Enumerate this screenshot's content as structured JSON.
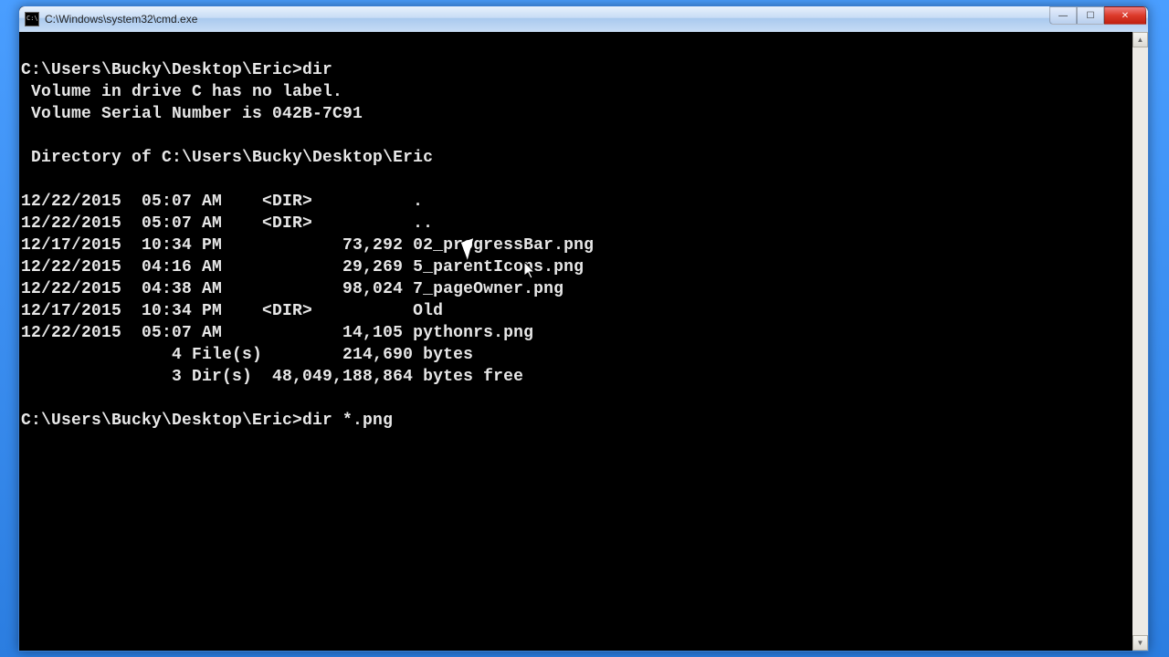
{
  "window": {
    "title": "C:\\Windows\\system32\\cmd.exe"
  },
  "term": {
    "l00": "",
    "l01": "C:\\Users\\Bucky\\Desktop\\Eric>dir",
    "l02": " Volume in drive C has no label.",
    "l03": " Volume Serial Number is 042B-7C91",
    "l04": "",
    "l05": " Directory of C:\\Users\\Bucky\\Desktop\\Eric",
    "l06": "",
    "l07": "12/22/2015  05:07 AM    <DIR>          .",
    "l08": "12/22/2015  05:07 AM    <DIR>          ..",
    "l09": "12/17/2015  10:34 PM            73,292 02_progressBar.png",
    "l10": "12/22/2015  04:16 AM            29,269 5_parentIcons.png",
    "l11": "12/22/2015  04:38 AM            98,024 7_pageOwner.png",
    "l12": "12/17/2015  10:34 PM    <DIR>          Old",
    "l13": "12/22/2015  05:07 AM            14,105 pythonrs.png",
    "l14": "               4 File(s)        214,690 bytes",
    "l15": "               3 Dir(s)  48,049,188,864 bytes free",
    "l16": "",
    "l17": "C:\\Users\\Bucky\\Desktop\\Eric>dir *.png"
  },
  "controls": {
    "min": "—",
    "max": "☐",
    "close": "✕"
  },
  "scroll": {
    "up": "▲",
    "down": "▼"
  }
}
